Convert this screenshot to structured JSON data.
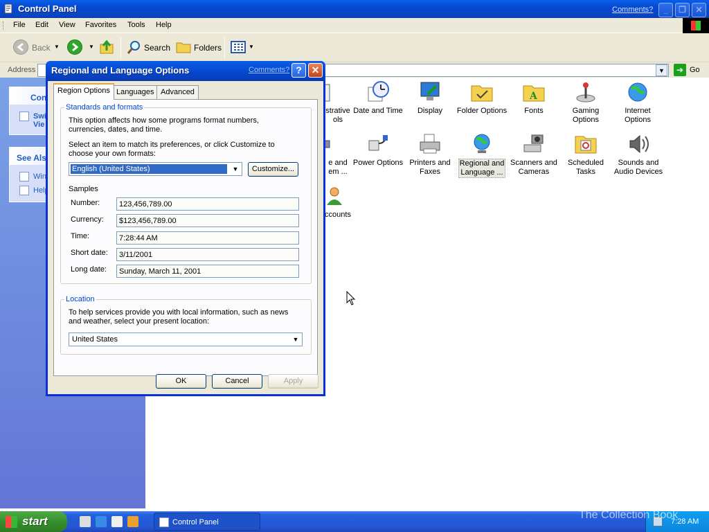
{
  "window": {
    "title": "Control Panel",
    "comments_link": "Comments?",
    "menu": [
      "File",
      "Edit",
      "View",
      "Favorites",
      "Tools",
      "Help"
    ],
    "toolbar": {
      "back": "Back",
      "search": "Search",
      "folders": "Folders"
    },
    "address": {
      "label": "Address",
      "go": "Go"
    }
  },
  "left_pane": {
    "control_panel_heading": "Con",
    "switch_view_lines": [
      "Swi",
      "Vie"
    ],
    "see_also_heading": "See Als",
    "see_also_items": [
      "Win",
      "Help"
    ]
  },
  "content": {
    "items": [
      {
        "label": "strative\nols",
        "icon": "administrative-tools-icon"
      },
      {
        "label": "Date and Time",
        "icon": "date-time-icon"
      },
      {
        "label": "Display",
        "icon": "display-icon"
      },
      {
        "label": "Folder Options",
        "icon": "folder-options-icon"
      },
      {
        "label": "Fonts",
        "icon": "fonts-icon"
      },
      {
        "label": "Gaming\nOptions",
        "icon": "gaming-options-icon"
      },
      {
        "label": "Internet\nOptions",
        "icon": "internet-options-icon"
      },
      {
        "label": "e and\nem ...",
        "icon": "phone-modem-icon"
      },
      {
        "label": "Power Options",
        "icon": "power-options-icon"
      },
      {
        "label": "Printers and\nFaxes",
        "icon": "printers-faxes-icon"
      },
      {
        "label": "Regional and\nLanguage ...",
        "icon": "regional-language-icon"
      },
      {
        "label": "Scanners and\nCameras",
        "icon": "scanners-cameras-icon"
      },
      {
        "label": "Scheduled\nTasks",
        "icon": "scheduled-tasks-icon"
      },
      {
        "label": "Sounds and\nAudio Devices",
        "icon": "sounds-audio-icon"
      },
      {
        "label": "ccounts",
        "icon": "user-accounts-icon"
      }
    ]
  },
  "dialog": {
    "title": "Regional and Language Options",
    "comments_link": "Comments?",
    "help_glyph": "?",
    "close_glyph": "✕",
    "tabs": [
      "Region Options",
      "Languages",
      "Advanced"
    ],
    "standards": {
      "legend": "Standards and formats",
      "description": "This option affects how some programs format numbers, currencies, dates, and time.",
      "select_prompt": "Select an item to match its preferences, or click Customize to choose your own formats:",
      "selected_format": "English (United States)",
      "customize_button": "Customize...",
      "samples_heading": "Samples",
      "samples": [
        {
          "label": "Number:",
          "value": "123,456,789.00"
        },
        {
          "label": "Currency:",
          "value": "$123,456,789.00"
        },
        {
          "label": "Time:",
          "value": "7:28:44 AM"
        },
        {
          "label": "Short date:",
          "value": "3/11/2001"
        },
        {
          "label": "Long date:",
          "value": "Sunday, March 11, 2001"
        }
      ]
    },
    "location": {
      "legend": "Location",
      "description": "To help services provide you with local information, such as news and weather, select your present location:",
      "selected_location": "United States"
    },
    "buttons": {
      "ok": "OK",
      "cancel": "Cancel",
      "apply": "Apply"
    }
  },
  "taskbar": {
    "start_label": "start",
    "task_label": "Control Panel",
    "clock": "7:28 AM"
  },
  "watermark": "The Collection Book",
  "colors": {
    "xp_blue": "#0a5ee8",
    "start_green": "#36902d",
    "dialog_face": "#ece9d8",
    "link_blue": "#215dc6"
  }
}
